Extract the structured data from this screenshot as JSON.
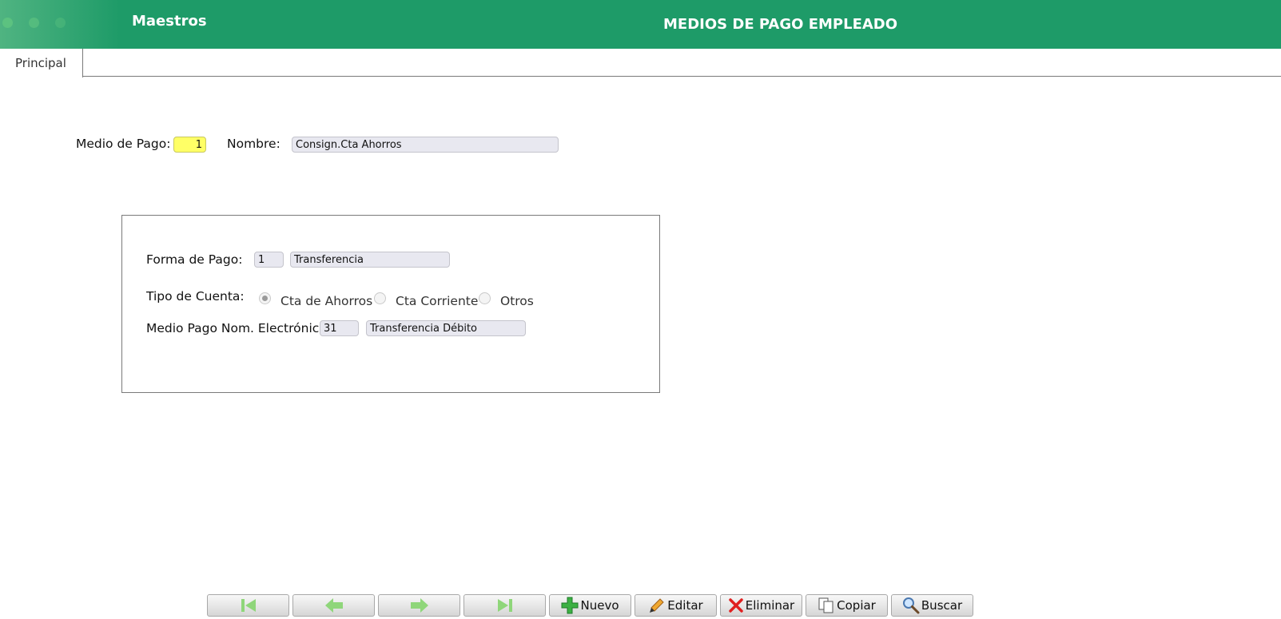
{
  "header": {
    "app_name": "Maestros",
    "title": "MEDIOS DE PAGO EMPLEADO",
    "accent_color": "#1e9b68"
  },
  "tabs": [
    {
      "label": "Principal",
      "active": true
    }
  ],
  "form": {
    "medio_pago_label": "Medio de Pago:",
    "medio_pago_value": "1",
    "nombre_label": "Nombre:",
    "nombre_value": "Consign.Cta  Ahorros"
  },
  "group": {
    "forma_pago_label": "Forma de Pago:",
    "forma_pago_code": "1",
    "forma_pago_desc": "Transferencia",
    "tipo_cuenta_label": "Tipo de Cuenta:",
    "tipo_cuenta_options": [
      "Cta de Ahorros",
      "Cta Corriente",
      "Otros"
    ],
    "tipo_cuenta_selected": "Cta de Ahorros",
    "medio_electronico_label": "Medio Pago Nom. Electrónica:",
    "medio_electronico_code": "31",
    "medio_electronico_desc": "Transferencia Débito"
  },
  "toolbar": {
    "nav_icons": [
      "first-record-icon",
      "previous-record-icon",
      "next-record-icon",
      "last-record-icon"
    ],
    "nuevo_label": "Nuevo",
    "editar_label": "Editar",
    "eliminar_label": "Eliminar",
    "copiar_label": "Copiar",
    "buscar_label": "Buscar"
  }
}
